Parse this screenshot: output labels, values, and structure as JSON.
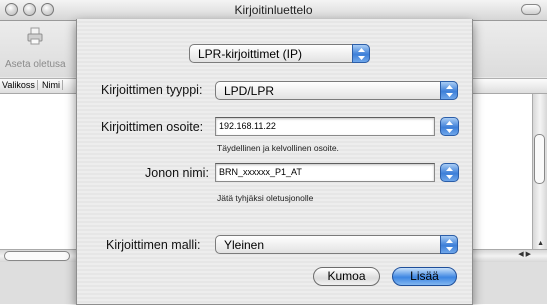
{
  "window": {
    "title": "Kirjoitinluettelo"
  },
  "toolbar": {
    "default_label": "Aseta oletusa"
  },
  "list": {
    "columns": [
      "Valikoss",
      "Nimi"
    ]
  },
  "sheet": {
    "protocol_popup": "LPR-kirjoittimet (IP)",
    "printer_type_label": "Kirjoittimen tyyppi:",
    "printer_type_value": "LPD/LPR",
    "address_label": "Kirjoittimen osoite:",
    "address_value": "192.168.11.22",
    "address_hint": "Täydellinen ja kelvollinen osoite.",
    "queue_label": "Jonon nimi:",
    "queue_value": "BRN_xxxxxx_P1_AT",
    "queue_hint": "Jätä tyhjäksi oletusjonolle",
    "model_label": "Kirjoittimen malli:",
    "model_value": "Yleinen",
    "cancel_button": "Kumoa",
    "add_button": "Lisää"
  },
  "colors": {
    "aqua_blue": "#3d7fd8",
    "sheet_bg": "#ececec"
  },
  "icons": [
    "close-icon",
    "minimize-icon",
    "zoom-icon",
    "printer-icon",
    "stepper-arrows-icon"
  ]
}
